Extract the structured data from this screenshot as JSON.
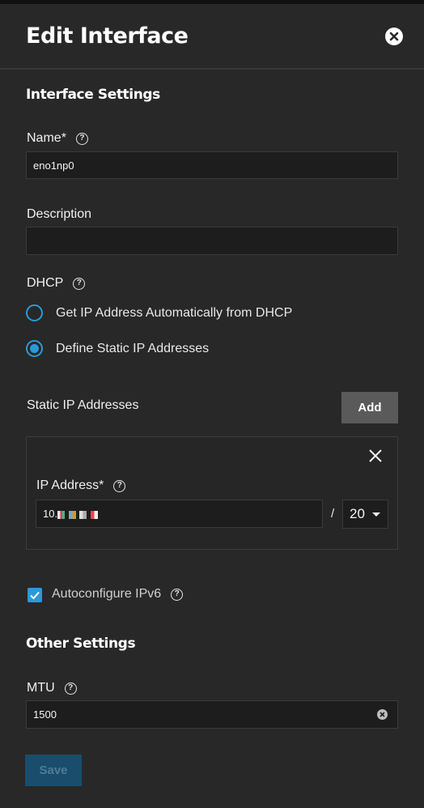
{
  "header": {
    "title": "Edit Interface",
    "close_icon": "close-circle-icon"
  },
  "interface_settings": {
    "section_title": "Interface Settings",
    "name": {
      "label": "Name",
      "required_marker": "*",
      "value": "eno1np0",
      "help_icon": "help-circle-icon"
    },
    "description": {
      "label": "Description",
      "value": ""
    },
    "dhcp": {
      "label": "DHCP",
      "help_icon": "help-circle-icon",
      "options": [
        {
          "label": "Get IP Address Automatically from DHCP",
          "selected": false
        },
        {
          "label": "Define Static IP Addresses",
          "selected": true
        }
      ]
    },
    "static_ips": {
      "label": "Static IP Addresses",
      "add_label": "Add",
      "entries": [
        {
          "label": "IP Address",
          "required_marker": "*",
          "value_visible_prefix": "10.",
          "netmask": "20",
          "remove_icon": "close-icon"
        }
      ]
    },
    "ipv6": {
      "label": "Autoconfigure IPv6",
      "checked": true,
      "help_icon": "help-circle-icon"
    }
  },
  "other_settings": {
    "section_title": "Other Settings",
    "mtu": {
      "label": "MTU",
      "value": "1500",
      "help_icon": "help-circle-icon",
      "clear_icon": "clear-icon"
    }
  },
  "footer": {
    "save_label": "Save"
  },
  "colors": {
    "accent": "#2b9ad8",
    "background": "#282828",
    "input_bg": "#1d1d1d",
    "save_disabled": "#1a4d6c"
  }
}
